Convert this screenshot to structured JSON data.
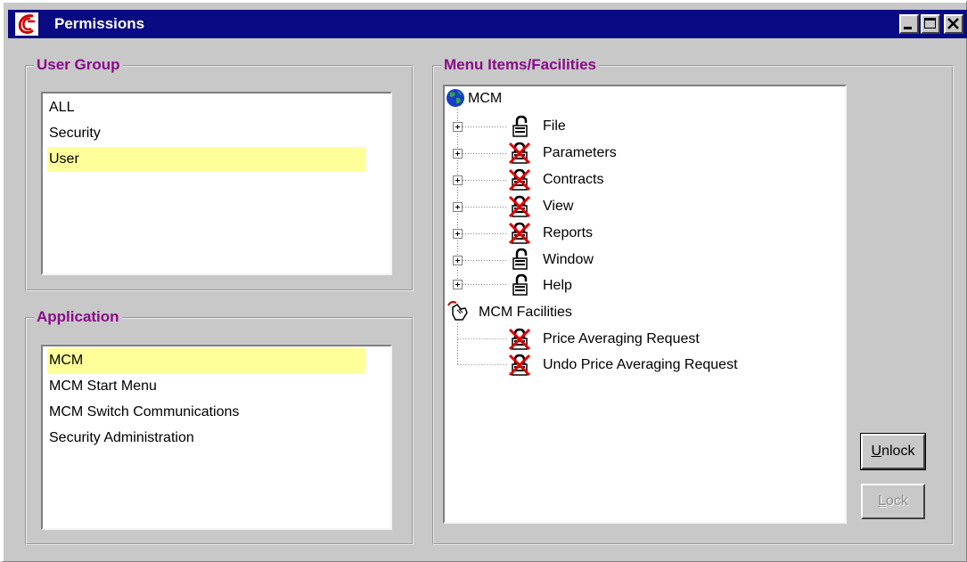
{
  "window": {
    "title": "Permissions"
  },
  "user_group": {
    "label": "User Group",
    "items": [
      {
        "label": "ALL",
        "selected": false
      },
      {
        "label": "Security",
        "selected": false
      },
      {
        "label": "User",
        "selected": true
      }
    ]
  },
  "application": {
    "label": "Application",
    "items": [
      {
        "label": "MCM",
        "selected": true
      },
      {
        "label": "MCM Start Menu",
        "selected": false
      },
      {
        "label": "MCM Switch Communications",
        "selected": false
      },
      {
        "label": "Security Administration",
        "selected": false
      }
    ]
  },
  "menu_items": {
    "label": "Menu Items/Facilities",
    "root": {
      "label": "MCM",
      "icon": "globe-icon"
    },
    "children": [
      {
        "label": "File",
        "icon": "padlock-open-icon",
        "locked": false
      },
      {
        "label": "Parameters",
        "icon": "padlock-locked-icon",
        "locked": true
      },
      {
        "label": "Contracts",
        "icon": "padlock-locked-icon",
        "locked": true
      },
      {
        "label": "View",
        "icon": "padlock-locked-icon",
        "locked": true
      },
      {
        "label": "Reports",
        "icon": "padlock-locked-icon",
        "locked": true
      },
      {
        "label": "Window",
        "icon": "padlock-open-icon",
        "locked": false
      },
      {
        "label": "Help",
        "icon": "padlock-open-icon",
        "locked": false
      }
    ],
    "facilities_root": {
      "label": "MCM Facilities",
      "icon": "facilities-hand-icon"
    },
    "facilities": [
      {
        "label": "Price Averaging Request",
        "icon": "padlock-locked-icon",
        "locked": true
      },
      {
        "label": "Undo Price Averaging Request",
        "icon": "padlock-locked-icon",
        "locked": true
      }
    ]
  },
  "buttons": {
    "unlock": {
      "label": "Unlock",
      "mnemonic": "U",
      "rest": "nlock",
      "enabled": true
    },
    "lock": {
      "label": "Lock",
      "mnemonic": "L",
      "rest": "ock",
      "enabled": false
    }
  },
  "colors": {
    "titlebar": "#0a0a84",
    "group_label": "#8a0a8a",
    "selection": "#ffff99",
    "window_bg": "#c8c8c8",
    "lock_cross": "#e00000"
  }
}
